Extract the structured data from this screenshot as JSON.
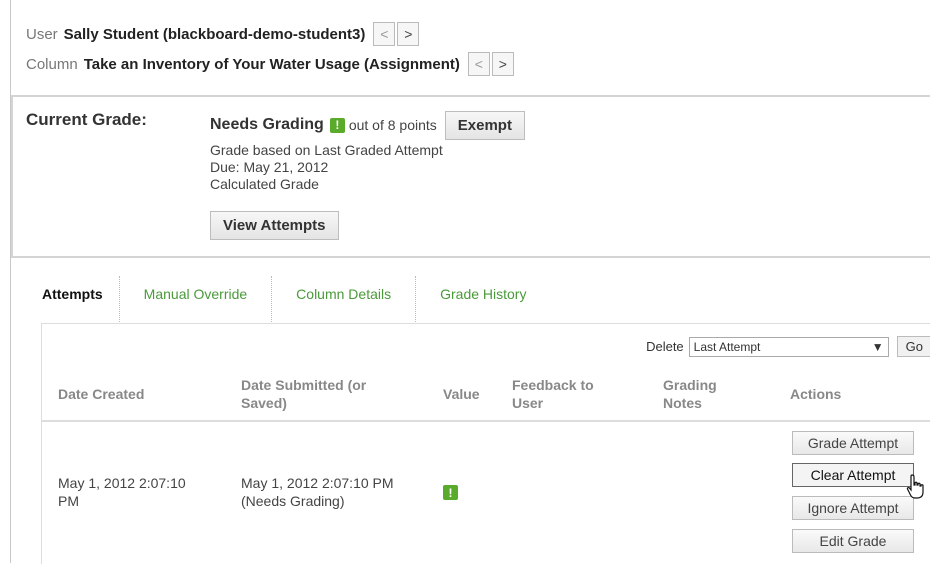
{
  "nav": {
    "user_label": "User",
    "user_value": "Sally Student (blackboard-demo-student3)",
    "column_label": "Column",
    "column_value": "Take an Inventory of Your Water Usage (Assignment)",
    "prev_glyph": "<",
    "next_glyph": ">"
  },
  "grade": {
    "label": "Current Grade:",
    "status": "Needs Grading",
    "badge": "!",
    "out_of": "out of 8 points",
    "exempt_label": "Exempt",
    "basis": "Grade based on Last Graded Attempt",
    "due": "Due: May 21, 2012",
    "calc": "Calculated Grade",
    "view_attempts_label": "View Attempts"
  },
  "tabs": [
    "Attempts",
    "Manual Override",
    "Column Details",
    "Grade History"
  ],
  "delete": {
    "label": "Delete",
    "selected": "Last Attempt",
    "go_label": "Go"
  },
  "table": {
    "headers": {
      "date_created": "Date Created",
      "date_submitted": "Date Submitted (or Saved)",
      "value": "Value",
      "feedback": "Feedback to User",
      "grading_notes": "Grading Notes",
      "actions": "Actions"
    },
    "row": {
      "date_created": "May 1, 2012 2:07:10 PM",
      "date_submitted": "May 1, 2012 2:07:10 PM (Needs Grading)",
      "value_badge": "!"
    },
    "actions": [
      "Grade Attempt",
      "Clear Attempt",
      "Ignore Attempt",
      "Edit Grade"
    ]
  },
  "colors": {
    "accent_green": "#5aab2b",
    "tab_link": "#4a9a3a"
  },
  "icons": {
    "cursor": "hand-pointer-icon",
    "status": "needs-grading-icon"
  }
}
